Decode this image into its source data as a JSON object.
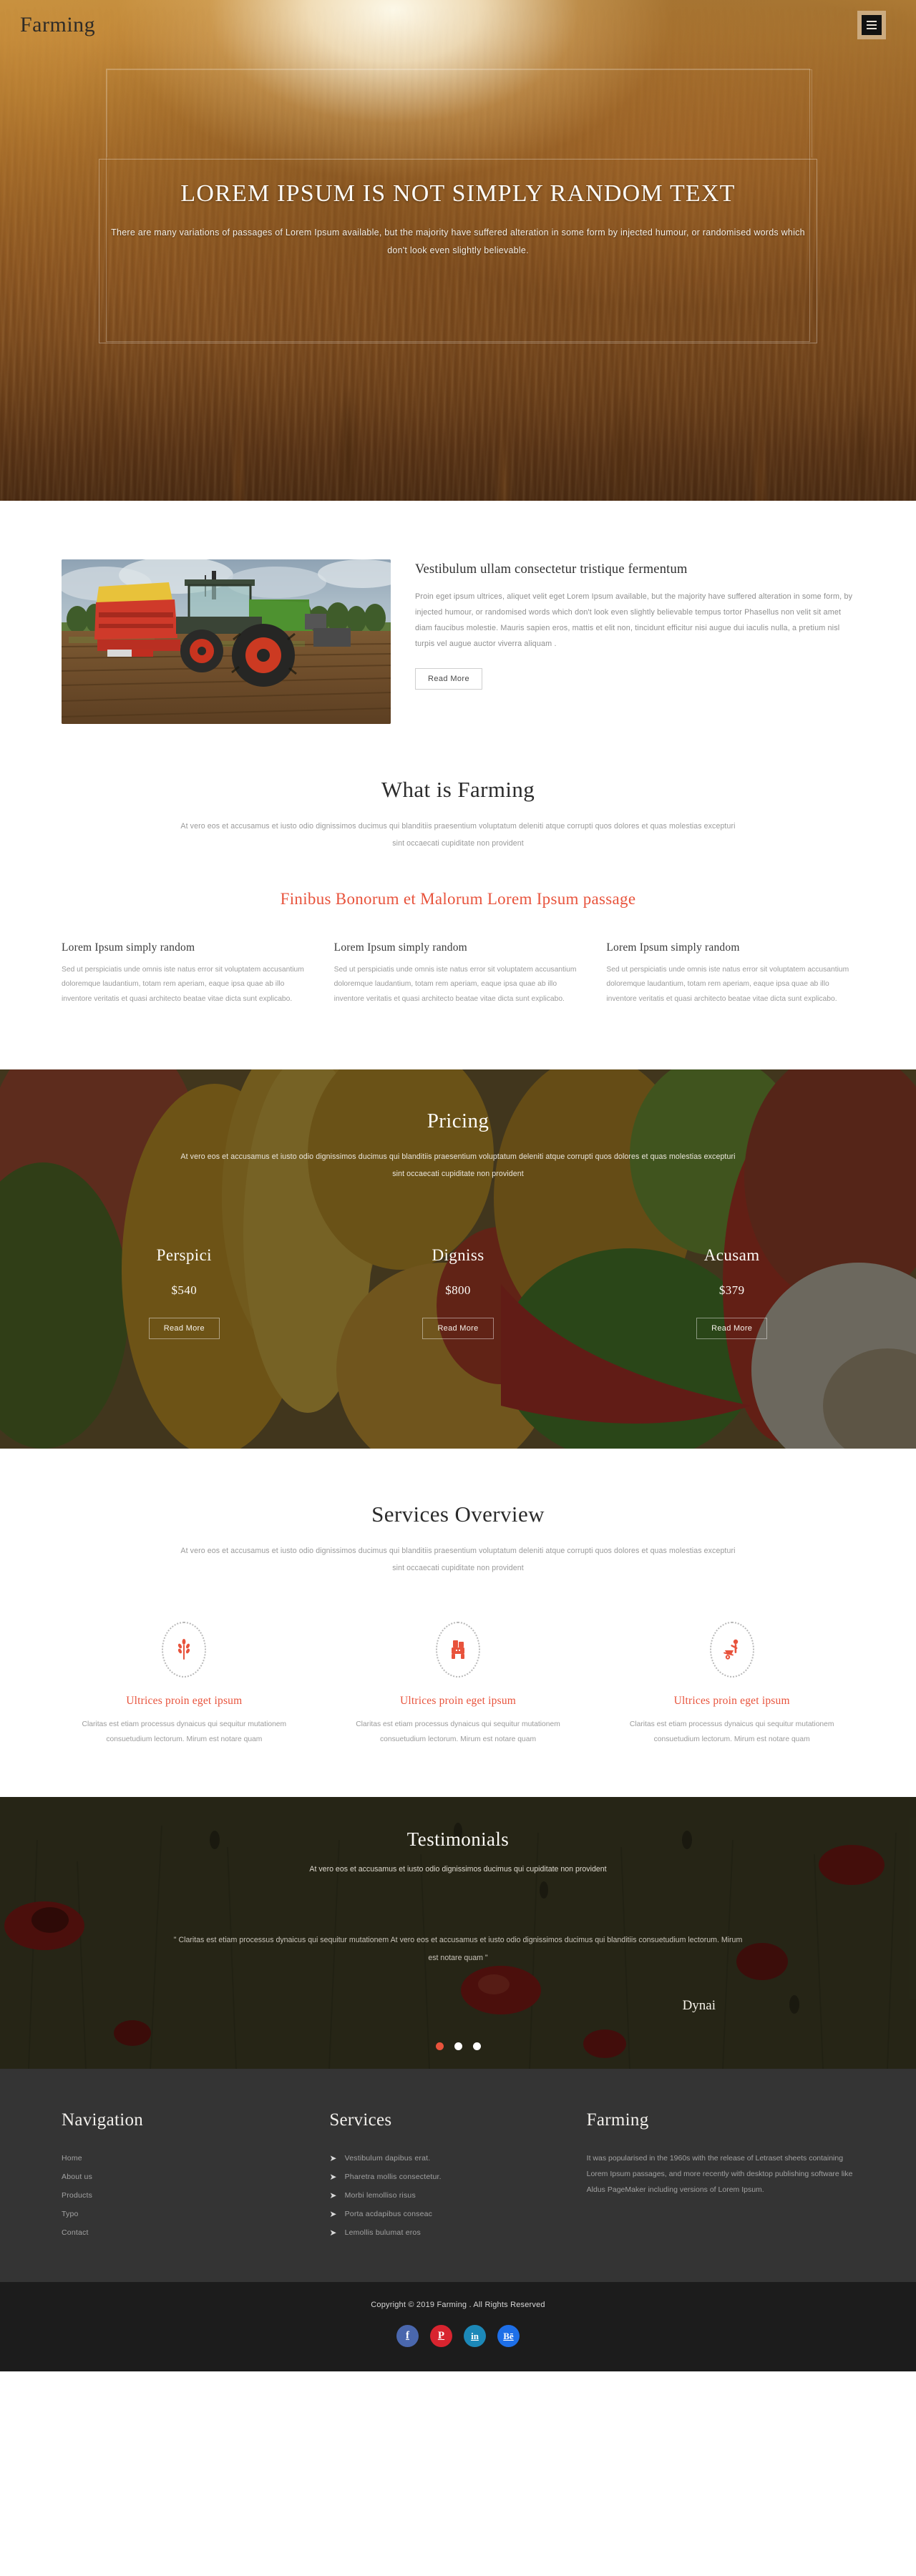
{
  "header": {
    "brand": "Farming",
    "menu_icon": "hamburger-icon"
  },
  "hero": {
    "title": "LOREM IPSUM IS NOT SIMPLY RANDOM TEXT",
    "subtitle": "There are many variations of passages of Lorem Ipsum available, but the majority have suffered alteration in some form by injected humour, or randomised words which don't look even slightly believable."
  },
  "intro": {
    "title": "Vestibulum ullam consectetur tristique fermentum",
    "text": "Proin eget ipsum ultrices, aliquet velit eget Lorem Ipsum available, but the majority have suffered alteration in some form, by injected humour, or randomised words which don't look even slightly believable tempus tortor Phasellus non velit sit amet diam faucibus molestie. Mauris sapien eros, mattis et elit non, tincidunt efficitur nisi augue dui iaculis nulla, a pretium nisl turpis vel augue auctor viverra aliquam .",
    "button": "Read More",
    "image_alt": "tractor-in-field"
  },
  "whatis": {
    "title": "What is Farming",
    "subtitle": "At vero eos et accusamus et iusto odio dignissimos ducimus qui blanditiis praesentium voluptatum deleniti atque corrupti quos dolores et quas molestias excepturi sint occaecati cupiditate non provident",
    "accent_title": "Finibus Bonorum et Malorum Lorem Ipsum passage",
    "columns": [
      {
        "title": "Lorem Ipsum simply random",
        "text": "Sed ut perspiciatis unde omnis iste natus error sit voluptatem accusantium doloremque laudantium, totam rem aperiam, eaque ipsa quae ab illo inventore veritatis et quasi architecto beatae vitae dicta sunt explicabo."
      },
      {
        "title": "Lorem Ipsum simply random",
        "text": "Sed ut perspiciatis unde omnis iste natus error sit voluptatem accusantium doloremque laudantium, totam rem aperiam, eaque ipsa quae ab illo inventore veritatis et quasi architecto beatae vitae dicta sunt explicabo."
      },
      {
        "title": "Lorem Ipsum simply random",
        "text": "Sed ut perspiciatis unde omnis iste natus error sit voluptatem accusantium doloremque laudantium, totam rem aperiam, eaque ipsa quae ab illo inventore veritatis et quasi architecto beatae vitae dicta sunt explicabo."
      }
    ]
  },
  "pricing": {
    "title": "Pricing",
    "subtitle": "At vero eos et accusamus et iusto odio dignissimos ducimus qui blanditiis praesentium voluptatum deleniti atque corrupti quos dolores et quas molestias excepturi sint occaecati cupiditate non provident",
    "plans": [
      {
        "name": "Perspici",
        "price": "$540",
        "button": "Read More"
      },
      {
        "name": "Digniss",
        "price": "$800",
        "button": "Read More"
      },
      {
        "name": "Acusam",
        "price": "$379",
        "button": "Read More"
      }
    ]
  },
  "services": {
    "title": "Services Overview",
    "subtitle": "At vero eos et accusamus et iusto odio dignissimos ducimus qui blanditiis praesentium voluptatum deleniti atque corrupti quos dolores et quas molestias excepturi sint occaecati cupiditate non provident",
    "items": [
      {
        "icon": "wheat-icon",
        "title": "Ultrices proin eget ipsum",
        "text": "Claritas est etiam processus dynaicus qui sequitur mutationem consuetudium lectorum. Mirum est notare quam"
      },
      {
        "icon": "tractor-icon",
        "title": "Ultrices proin eget ipsum",
        "text": "Claritas est etiam processus dynaicus qui sequitur mutationem consuetudium lectorum. Mirum est notare quam"
      },
      {
        "icon": "wheelbarrow-icon",
        "title": "Ultrices proin eget ipsum",
        "text": "Claritas est etiam processus dynaicus qui sequitur mutationem consuetudium lectorum. Mirum est notare quam"
      }
    ]
  },
  "testimonials": {
    "title": "Testimonials",
    "lead": "At vero eos et accusamus et iusto odio dignissimos ducimus qui cupiditate non provident",
    "quote": "\" Claritas est etiam processus dynaicus qui sequitur mutationem At vero eos et accusamus et iusto odio dignissimos ducimus qui blanditiis consuetudium lectorum. Mirum est notare quam \"",
    "author": "Dynai",
    "dots": [
      true,
      false,
      false
    ]
  },
  "footer": {
    "nav": {
      "title": "Navigation",
      "items": [
        "Home",
        "About us",
        "Products",
        "Typo",
        "Contact"
      ]
    },
    "services": {
      "title": "Services",
      "items": [
        "Vestibulum dapibus erat.",
        "Pharetra mollis consectetur.",
        "Morbi lemolliso risus",
        "Porta acdapibus conseac",
        "Lemollis bulumat eros"
      ]
    },
    "about": {
      "title": "Farming",
      "text": "It was popularised in the 1960s with the release of Letraset sheets containing Lorem Ipsum passages, and more recently with desktop publishing software like Aldus PageMaker including versions of Lorem Ipsum."
    },
    "copyright": "Copyright © 2019 Farming . All Rights Reserved",
    "socials": [
      {
        "name": "facebook-icon",
        "glyph": "f",
        "color": "#4a67ad"
      },
      {
        "name": "pinterest-icon",
        "glyph": "P",
        "color": "#d8242f"
      },
      {
        "name": "linkedin-icon",
        "glyph": "in",
        "color": "#1c88b8"
      },
      {
        "name": "behance-icon",
        "glyph": "Bē",
        "color": "#1e6fe8"
      }
    ]
  },
  "colors": {
    "accent": "#e8533c",
    "footer_bg": "#343434",
    "copy_bg": "#1c1c1c"
  }
}
